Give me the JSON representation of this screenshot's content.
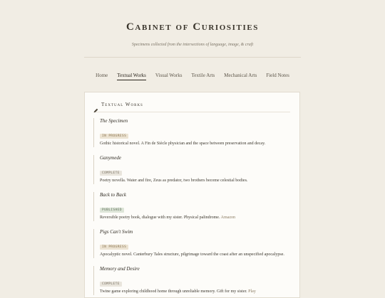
{
  "site": {
    "title": "Cabinet of Curiosities",
    "subtitle": "Specimens collected from the intersections of language, image, & craft"
  },
  "nav": {
    "items": [
      {
        "label": "Home"
      },
      {
        "label": "Textual Works"
      },
      {
        "label": "Visual Works"
      },
      {
        "label": "Textile Arts"
      },
      {
        "label": "Mechanical Arts"
      },
      {
        "label": "Field Notes"
      }
    ],
    "active": "Textual Works"
  },
  "section": {
    "icon": "pencil-icon",
    "title": "Textual Works"
  },
  "entries": [
    {
      "title": "The Specimen",
      "status": "IN PROGRESS",
      "description": "Gothic historical novel. A Fin de Siècle physician and the space between preservation and decay.",
      "link": ""
    },
    {
      "title": "Ganymede",
      "status": "COMPLETE",
      "description": "Poetry novella. Water and fire, Zeus as predator, two brothers become celestial bodies.",
      "link": ""
    },
    {
      "title": "Back to Back",
      "status": "PUBLISHED",
      "description": "Reversible poetry book, dialogue with my sister. Physical palindrome.",
      "link": "Amazon"
    },
    {
      "title": "Pigs Can't Swim",
      "status": "IN PROGRESS",
      "description": "Apocalyptic novel. Canterbury Tales structure, pilgrimage toward the coast after an unspecified apocalypse.",
      "link": ""
    },
    {
      "title": "Memory and Desire",
      "status": "COMPLETE",
      "description": "Twine game exploring childhood home through unreliable memory. Gift for my sister.",
      "link": "Play"
    }
  ],
  "colors": {
    "background": "#f1ede4",
    "panel": "#fdfcf9",
    "in_progress": "#ece3d2",
    "complete": "#e9e5dc",
    "published": "#dde5d8"
  }
}
